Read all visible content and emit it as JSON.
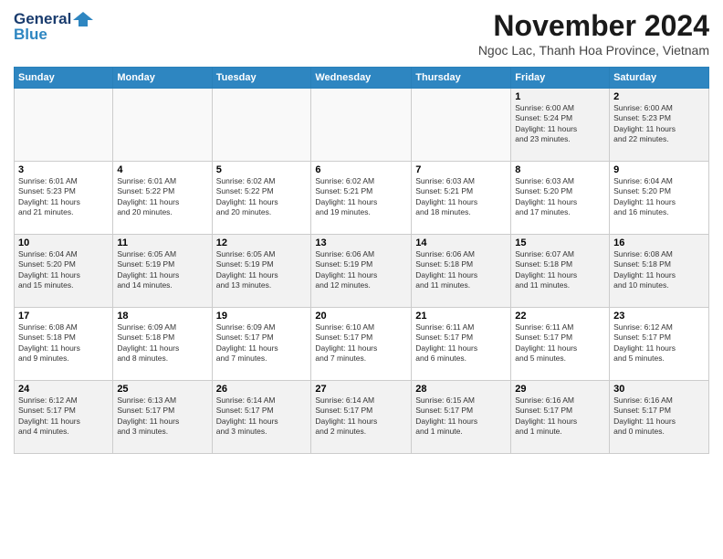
{
  "logo": {
    "line1": "General",
    "line2": "Blue"
  },
  "header": {
    "title": "November 2024",
    "subtitle": "Ngoc Lac, Thanh Hoa Province, Vietnam"
  },
  "weekdays": [
    "Sunday",
    "Monday",
    "Tuesday",
    "Wednesday",
    "Thursday",
    "Friday",
    "Saturday"
  ],
  "weeks": [
    [
      {
        "day": "",
        "info": ""
      },
      {
        "day": "",
        "info": ""
      },
      {
        "day": "",
        "info": ""
      },
      {
        "day": "",
        "info": ""
      },
      {
        "day": "",
        "info": ""
      },
      {
        "day": "1",
        "info": "Sunrise: 6:00 AM\nSunset: 5:24 PM\nDaylight: 11 hours\nand 23 minutes."
      },
      {
        "day": "2",
        "info": "Sunrise: 6:00 AM\nSunset: 5:23 PM\nDaylight: 11 hours\nand 22 minutes."
      }
    ],
    [
      {
        "day": "3",
        "info": "Sunrise: 6:01 AM\nSunset: 5:23 PM\nDaylight: 11 hours\nand 21 minutes."
      },
      {
        "day": "4",
        "info": "Sunrise: 6:01 AM\nSunset: 5:22 PM\nDaylight: 11 hours\nand 20 minutes."
      },
      {
        "day": "5",
        "info": "Sunrise: 6:02 AM\nSunset: 5:22 PM\nDaylight: 11 hours\nand 20 minutes."
      },
      {
        "day": "6",
        "info": "Sunrise: 6:02 AM\nSunset: 5:21 PM\nDaylight: 11 hours\nand 19 minutes."
      },
      {
        "day": "7",
        "info": "Sunrise: 6:03 AM\nSunset: 5:21 PM\nDaylight: 11 hours\nand 18 minutes."
      },
      {
        "day": "8",
        "info": "Sunrise: 6:03 AM\nSunset: 5:20 PM\nDaylight: 11 hours\nand 17 minutes."
      },
      {
        "day": "9",
        "info": "Sunrise: 6:04 AM\nSunset: 5:20 PM\nDaylight: 11 hours\nand 16 minutes."
      }
    ],
    [
      {
        "day": "10",
        "info": "Sunrise: 6:04 AM\nSunset: 5:20 PM\nDaylight: 11 hours\nand 15 minutes."
      },
      {
        "day": "11",
        "info": "Sunrise: 6:05 AM\nSunset: 5:19 PM\nDaylight: 11 hours\nand 14 minutes."
      },
      {
        "day": "12",
        "info": "Sunrise: 6:05 AM\nSunset: 5:19 PM\nDaylight: 11 hours\nand 13 minutes."
      },
      {
        "day": "13",
        "info": "Sunrise: 6:06 AM\nSunset: 5:19 PM\nDaylight: 11 hours\nand 12 minutes."
      },
      {
        "day": "14",
        "info": "Sunrise: 6:06 AM\nSunset: 5:18 PM\nDaylight: 11 hours\nand 11 minutes."
      },
      {
        "day": "15",
        "info": "Sunrise: 6:07 AM\nSunset: 5:18 PM\nDaylight: 11 hours\nand 11 minutes."
      },
      {
        "day": "16",
        "info": "Sunrise: 6:08 AM\nSunset: 5:18 PM\nDaylight: 11 hours\nand 10 minutes."
      }
    ],
    [
      {
        "day": "17",
        "info": "Sunrise: 6:08 AM\nSunset: 5:18 PM\nDaylight: 11 hours\nand 9 minutes."
      },
      {
        "day": "18",
        "info": "Sunrise: 6:09 AM\nSunset: 5:18 PM\nDaylight: 11 hours\nand 8 minutes."
      },
      {
        "day": "19",
        "info": "Sunrise: 6:09 AM\nSunset: 5:17 PM\nDaylight: 11 hours\nand 7 minutes."
      },
      {
        "day": "20",
        "info": "Sunrise: 6:10 AM\nSunset: 5:17 PM\nDaylight: 11 hours\nand 7 minutes."
      },
      {
        "day": "21",
        "info": "Sunrise: 6:11 AM\nSunset: 5:17 PM\nDaylight: 11 hours\nand 6 minutes."
      },
      {
        "day": "22",
        "info": "Sunrise: 6:11 AM\nSunset: 5:17 PM\nDaylight: 11 hours\nand 5 minutes."
      },
      {
        "day": "23",
        "info": "Sunrise: 6:12 AM\nSunset: 5:17 PM\nDaylight: 11 hours\nand 5 minutes."
      }
    ],
    [
      {
        "day": "24",
        "info": "Sunrise: 6:12 AM\nSunset: 5:17 PM\nDaylight: 11 hours\nand 4 minutes."
      },
      {
        "day": "25",
        "info": "Sunrise: 6:13 AM\nSunset: 5:17 PM\nDaylight: 11 hours\nand 3 minutes."
      },
      {
        "day": "26",
        "info": "Sunrise: 6:14 AM\nSunset: 5:17 PM\nDaylight: 11 hours\nand 3 minutes."
      },
      {
        "day": "27",
        "info": "Sunrise: 6:14 AM\nSunset: 5:17 PM\nDaylight: 11 hours\nand 2 minutes."
      },
      {
        "day": "28",
        "info": "Sunrise: 6:15 AM\nSunset: 5:17 PM\nDaylight: 11 hours\nand 1 minute."
      },
      {
        "day": "29",
        "info": "Sunrise: 6:16 AM\nSunset: 5:17 PM\nDaylight: 11 hours\nand 1 minute."
      },
      {
        "day": "30",
        "info": "Sunrise: 6:16 AM\nSunset: 5:17 PM\nDaylight: 11 hours\nand 0 minutes."
      }
    ]
  ]
}
